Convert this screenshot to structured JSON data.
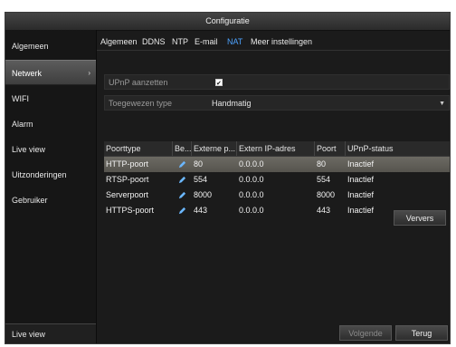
{
  "window": {
    "title": "Configuratie"
  },
  "sidebar": {
    "items": [
      {
        "label": "Algemeen"
      },
      {
        "label": "Netwerk",
        "chevron": "›"
      },
      {
        "label": "WIFI"
      },
      {
        "label": "Alarm"
      },
      {
        "label": "Live view"
      },
      {
        "label": "Uitzonderingen"
      },
      {
        "label": "Gebruiker"
      }
    ],
    "bottom_label": "Live view"
  },
  "tabs": [
    "Algemeen",
    "DDNS",
    "NTP",
    "E-mail",
    "NAT",
    "Meer instellingen"
  ],
  "active_tab": "NAT",
  "upnp": {
    "label": "UPnP aanzetten",
    "checked": true
  },
  "assign": {
    "label": "Toegewezen type",
    "value": "Handmatig"
  },
  "table": {
    "headers": [
      "Poorttype",
      "Be...",
      "Externe p...",
      "Extern IP-adres",
      "Poort",
      "UPnP-status"
    ],
    "rows": [
      {
        "type": "HTTP-poort",
        "ext_port": "80",
        "ext_ip": "0.0.0.0",
        "port": "80",
        "status": "Inactief"
      },
      {
        "type": "RTSP-poort",
        "ext_port": "554",
        "ext_ip": "0.0.0.0",
        "port": "554",
        "status": "Inactief"
      },
      {
        "type": "Serverpoort",
        "ext_port": "8000",
        "ext_ip": "0.0.0.0",
        "port": "8000",
        "status": "Inactief"
      },
      {
        "type": "HTTPS-poort",
        "ext_port": "443",
        "ext_ip": "0.0.0.0",
        "port": "443",
        "status": "Inactief"
      }
    ]
  },
  "buttons": {
    "refresh": "Ververs",
    "next": "Volgende",
    "back": "Terug"
  },
  "colors": {
    "accent": "#4da3ff",
    "selected_row": "#615f58"
  }
}
